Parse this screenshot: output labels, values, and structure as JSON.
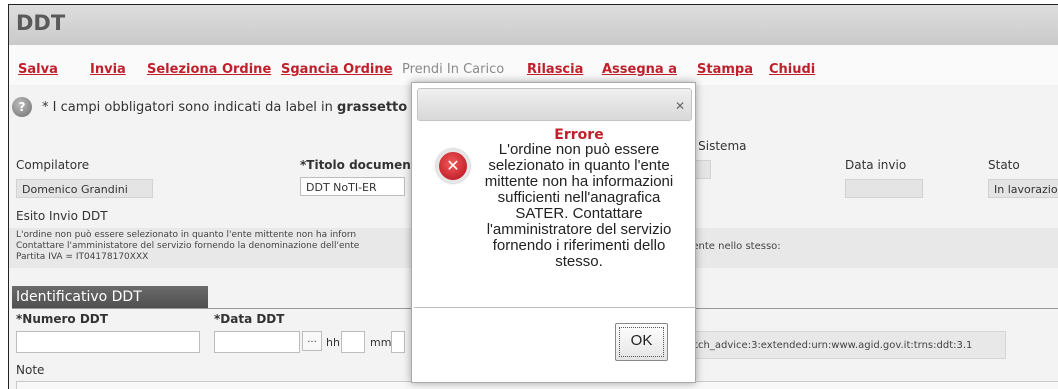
{
  "page_title": "DDT",
  "toolbar": {
    "salva": "Salva",
    "invia": "Invia",
    "seleziona_ordine": "Seleziona Ordine",
    "sgancia_ordine": "Sgancia Ordine",
    "prendi_in_carico": "Prendi In Carico",
    "rilascia": "Rilascia",
    "assegna_a": "Assegna a",
    "stampa": "Stampa",
    "chiudi": "Chiudi"
  },
  "info": {
    "text": "* I campi obbligatori sono indicati da label in ",
    "bold": "grassetto"
  },
  "fields": {
    "sistema_label": "i Sistema",
    "compilatore_label": "Compilatore",
    "compilatore_value": "Domenico Grandini",
    "titolo_label": "*Titolo documen",
    "titolo_value": "DDT NoTI-ER",
    "data_invio_label": "Data invio",
    "stato_label": "Stato",
    "stato_value": "In lavorazio",
    "esito_label": "Esito Invio DDT",
    "esito_line1": "L'ordine non può essere selezionato in quanto l'ente mittente non ha inforn",
    "esito_line2": "Contattare l'amministatore del servizio fornendo la denominazione dell'ente",
    "esito_line3": "Partita IVA = IT04178170XXX",
    "esito_right": "esente nello stesso:"
  },
  "section": {
    "title": "Identificativo DDT",
    "numero_label": "*Numero DDT",
    "data_label": "*Data DDT",
    "dots": "...",
    "hh": "hh",
    "mm": "mm",
    "version_value": "atch_advice:3:extended:urn:www.agid.gov.it:trns:ddt:3.1",
    "note_label": "Note"
  },
  "modal": {
    "close": "✕",
    "title": "Errore",
    "message": "L'ordine non può essere selezionato in quanto l'ente mittente non ha informazioni sufficienti nell'anagrafica SATER. Contattare l'amministratore del servizio fornendo i riferimenti dello stesso.",
    "ok": "OK"
  },
  "colors": {
    "accent": "#c0202c",
    "header_gray": "#d3d3d3"
  },
  "icons": {
    "help": "help-icon",
    "error": "error-icon",
    "close": "close-icon"
  }
}
